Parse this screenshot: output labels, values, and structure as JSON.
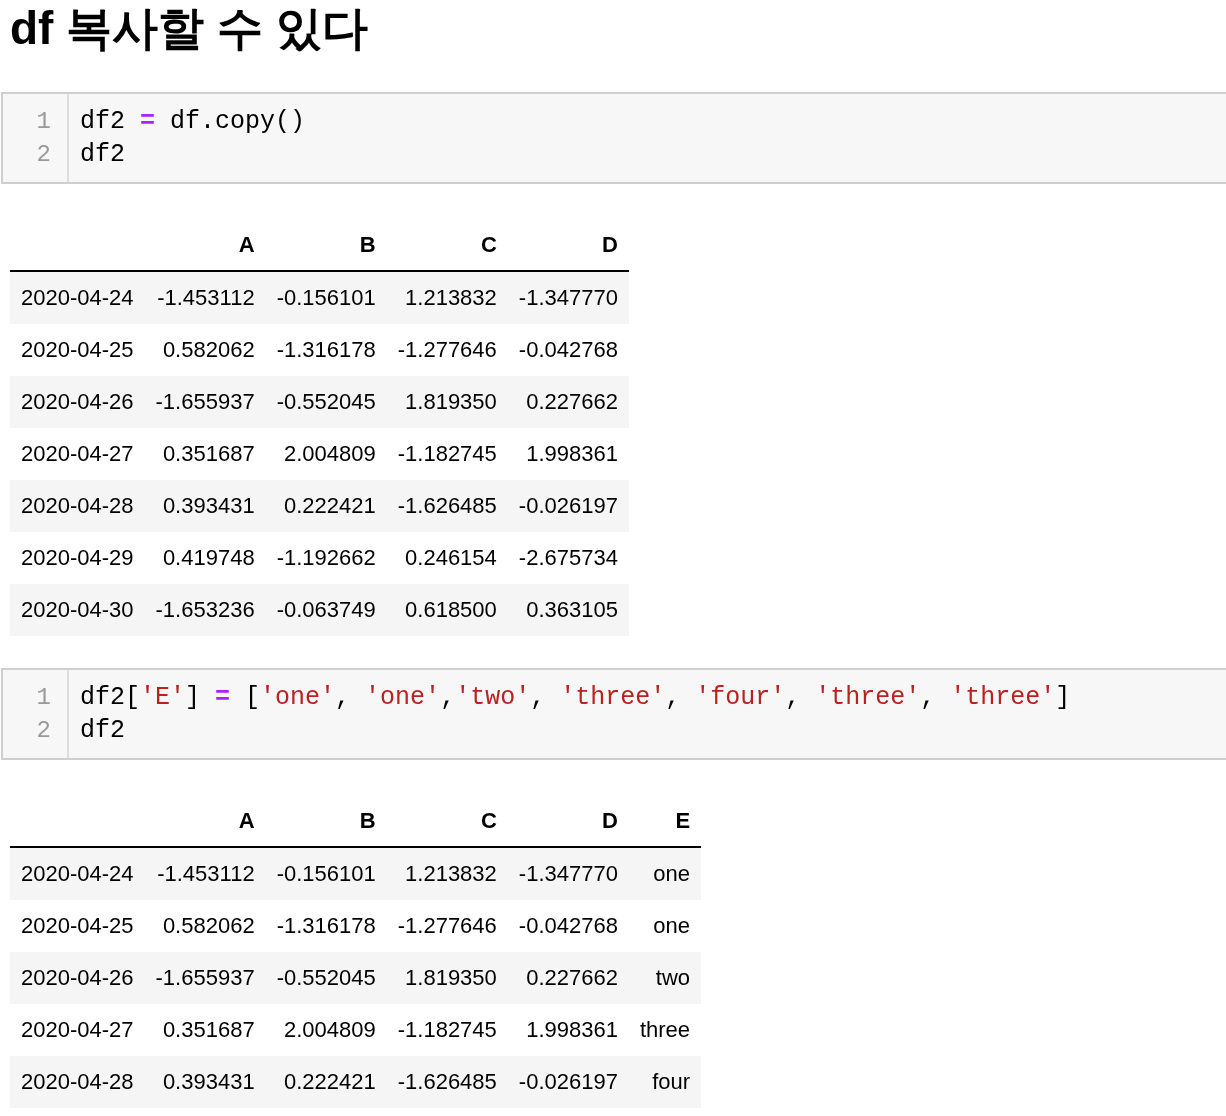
{
  "heading": "df 복사할 수 있다",
  "cells": [
    {
      "code": {
        "lines": [
          {
            "number": "1",
            "tokens": [
              {
                "text": "df2 ",
                "kind": "plain"
              },
              {
                "text": "=",
                "kind": "operator"
              },
              {
                "text": " df.copy()",
                "kind": "plain"
              }
            ]
          },
          {
            "number": "2",
            "tokens": [
              {
                "text": "df2",
                "kind": "plain"
              }
            ]
          }
        ]
      },
      "output": {
        "columns": [
          "",
          "A",
          "B",
          "C",
          "D"
        ],
        "rows": [
          [
            "2020-04-24",
            "-1.453112",
            "-0.156101",
            "1.213832",
            "-1.347770"
          ],
          [
            "2020-04-25",
            "0.582062",
            "-1.316178",
            "-1.277646",
            "-0.042768"
          ],
          [
            "2020-04-26",
            "-1.655937",
            "-0.552045",
            "1.819350",
            "0.227662"
          ],
          [
            "2020-04-27",
            "0.351687",
            "2.004809",
            "-1.182745",
            "1.998361"
          ],
          [
            "2020-04-28",
            "0.393431",
            "0.222421",
            "-1.626485",
            "-0.026197"
          ],
          [
            "2020-04-29",
            "0.419748",
            "-1.192662",
            "0.246154",
            "-2.675734"
          ],
          [
            "2020-04-30",
            "-1.653236",
            "-0.063749",
            "0.618500",
            "0.363105"
          ]
        ]
      }
    },
    {
      "code": {
        "lines": [
          {
            "number": "1",
            "tokens": [
              {
                "text": "df2[",
                "kind": "plain"
              },
              {
                "text": "'E'",
                "kind": "string"
              },
              {
                "text": "] ",
                "kind": "plain"
              },
              {
                "text": "=",
                "kind": "operator"
              },
              {
                "text": " [",
                "kind": "plain"
              },
              {
                "text": "'one'",
                "kind": "string"
              },
              {
                "text": ", ",
                "kind": "plain"
              },
              {
                "text": "'one'",
                "kind": "string"
              },
              {
                "text": ",",
                "kind": "plain"
              },
              {
                "text": "'two'",
                "kind": "string"
              },
              {
                "text": ", ",
                "kind": "plain"
              },
              {
                "text": "'three'",
                "kind": "string"
              },
              {
                "text": ", ",
                "kind": "plain"
              },
              {
                "text": "'four'",
                "kind": "string"
              },
              {
                "text": ", ",
                "kind": "plain"
              },
              {
                "text": "'three'",
                "kind": "string"
              },
              {
                "text": ", ",
                "kind": "plain"
              },
              {
                "text": "'three'",
                "kind": "string"
              },
              {
                "text": "]",
                "kind": "plain"
              }
            ]
          },
          {
            "number": "2",
            "tokens": [
              {
                "text": "df2",
                "kind": "plain"
              }
            ]
          }
        ]
      },
      "output": {
        "columns": [
          "",
          "A",
          "B",
          "C",
          "D",
          "E"
        ],
        "rows": [
          [
            "2020-04-24",
            "-1.453112",
            "-0.156101",
            "1.213832",
            "-1.347770",
            "one"
          ],
          [
            "2020-04-25",
            "0.582062",
            "-1.316178",
            "-1.277646",
            "-0.042768",
            "one"
          ],
          [
            "2020-04-26",
            "-1.655937",
            "-0.552045",
            "1.819350",
            "0.227662",
            "two"
          ],
          [
            "2020-04-27",
            "0.351687",
            "2.004809",
            "-1.182745",
            "1.998361",
            "three"
          ],
          [
            "2020-04-28",
            "0.393431",
            "0.222421",
            "-1.626485",
            "-0.026197",
            "four"
          ]
        ]
      }
    }
  ]
}
